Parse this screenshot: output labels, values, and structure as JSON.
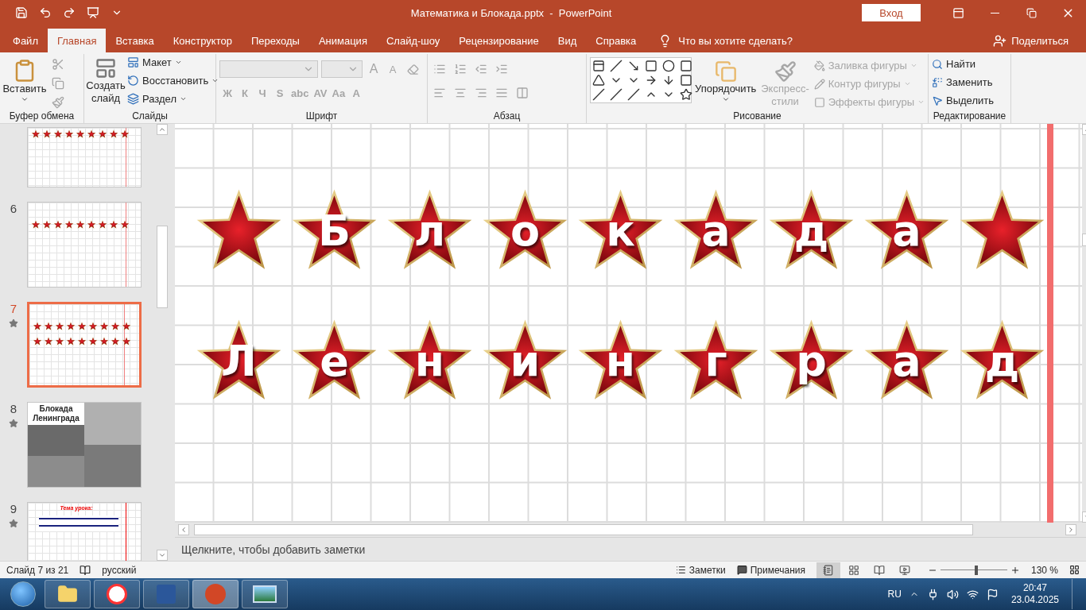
{
  "window": {
    "title": "Математика и Блокада.pptx  -  PowerPoint",
    "sign_in": "Вход"
  },
  "menu_tabs": [
    {
      "label": "Файл",
      "selected": false
    },
    {
      "label": "Главная",
      "selected": true
    },
    {
      "label": "Вставка",
      "selected": false
    },
    {
      "label": "Конструктор",
      "selected": false
    },
    {
      "label": "Переходы",
      "selected": false
    },
    {
      "label": "Анимация",
      "selected": false
    },
    {
      "label": "Слайд-шоу",
      "selected": false
    },
    {
      "label": "Рецензирование",
      "selected": false
    },
    {
      "label": "Вид",
      "selected": false
    },
    {
      "label": "Справка",
      "selected": false
    }
  ],
  "tell_me": "Что вы хотите сделать?",
  "share": "Поделиться",
  "clipboard": {
    "title": "Буфер обмена",
    "paste": "Вставить"
  },
  "slides_group": {
    "title": "Слайды",
    "new_slide": "Создать слайд",
    "items": [
      "Макет",
      "Восстановить",
      "Раздел"
    ]
  },
  "font": {
    "title": "Шрифт",
    "disabled": true,
    "size_buttons": [
      "A",
      "A"
    ],
    "buttons": [
      "Ж",
      "К",
      "Ч",
      "S",
      "abc",
      "AV",
      "Aa",
      "A"
    ]
  },
  "paragraph": {
    "title": "Абзац",
    "disabled": true
  },
  "drawing": {
    "title": "Рисование",
    "arrange": "Упорядочить",
    "quick_styles": {
      "label": "Экспресс-стили",
      "disabled": true
    },
    "commands": [
      {
        "label": "Заливка фигуры",
        "disabled": true
      },
      {
        "label": "Контур фигуры",
        "disabled": true
      },
      {
        "label": "Эффекты фигуры",
        "disabled": true
      }
    ]
  },
  "editing": {
    "title": "Редактирование",
    "commands": [
      "Найти",
      "Заменить",
      "Выделить"
    ]
  },
  "thumbnails": [
    {
      "kind": "stars_one",
      "selected": false,
      "animated": false
    },
    {
      "number": "6",
      "kind": "stars_one",
      "selected": false,
      "animated": false
    },
    {
      "number": "7",
      "kind": "stars_two",
      "selected": true,
      "animated": true
    },
    {
      "number": "8",
      "kind": "photos",
      "title": "Блокада Ленинграда",
      "selected": false,
      "animated": true
    },
    {
      "number": "9",
      "kind": "text",
      "title": "Тема урока:",
      "selected": false,
      "animated": true
    }
  ],
  "slide": {
    "rows": [
      {
        "badges": [
          {
            "kind": "plain"
          },
          {
            "kind": "letter",
            "letter": "Б"
          },
          {
            "kind": "letter",
            "letter": "л"
          },
          {
            "kind": "letter",
            "letter": "о"
          },
          {
            "kind": "letter",
            "letter": "к"
          },
          {
            "kind": "letter",
            "letter": "а"
          },
          {
            "kind": "letter",
            "letter": "д"
          },
          {
            "kind": "letter",
            "letter": "а"
          },
          {
            "kind": "plain"
          }
        ]
      },
      {
        "badges": [
          {
            "kind": "letter",
            "letter": "Л"
          },
          {
            "kind": "letter",
            "letter": "е"
          },
          {
            "kind": "letter",
            "letter": "н"
          },
          {
            "kind": "letter",
            "letter": "и"
          },
          {
            "kind": "letter",
            "letter": "н"
          },
          {
            "kind": "letter",
            "letter": "г"
          },
          {
            "kind": "letter",
            "letter": "р"
          },
          {
            "kind": "letter",
            "letter": "а"
          },
          {
            "kind": "letter",
            "letter": "д"
          }
        ]
      }
    ]
  },
  "notes": {
    "placeholder": "Щелкните, чтобы добавить заметки"
  },
  "status_bar": {
    "slide_info": "Слайд 7 из 21",
    "language": "русский",
    "notes": "Заметки",
    "comments": "Примечания",
    "views": [
      {
        "selected": true
      },
      {
        "selected": false
      },
      {
        "selected": false
      },
      {
        "selected": false
      }
    ],
    "zoom": {
      "level": 0.54,
      "reading": "130 %"
    }
  },
  "taskbar": {
    "apps": [
      {
        "kind": "explorer",
        "selected": false
      },
      {
        "kind": "browser",
        "selected": false
      },
      {
        "kind": "word",
        "selected": false
      },
      {
        "kind": "powerpoint",
        "selected": true
      },
      {
        "kind": "photos",
        "selected": false
      }
    ],
    "language": "RU",
    "time": "20:47",
    "date": "23.04.2025"
  }
}
